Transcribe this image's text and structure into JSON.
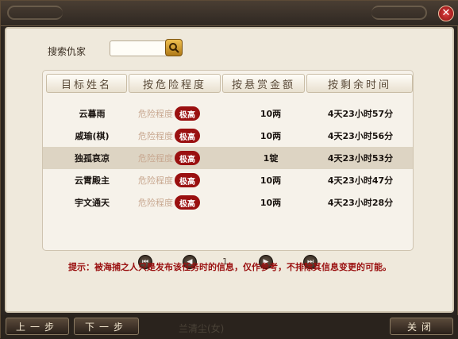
{
  "window": {
    "close_glyph": "✕"
  },
  "search": {
    "label": "搜索仇家",
    "value": ""
  },
  "columns": [
    "目标姓名",
    "按危险程度",
    "按悬赏金额",
    "按剩余时间"
  ],
  "rows": [
    {
      "name": "云暮雨",
      "danger": "危险程度",
      "level": "极高",
      "reward": "10两",
      "time": "4天23小时57分",
      "selected": false
    },
    {
      "name": "戚瑜(棋)",
      "danger": "危险程度",
      "level": "极高",
      "reward": "10两",
      "time": "4天23小时56分",
      "selected": false
    },
    {
      "name": "独孤哀凉",
      "danger": "危险程度",
      "level": "极高",
      "reward": "1锭",
      "time": "4天23小时53分",
      "selected": true
    },
    {
      "name": "云霄殿主",
      "danger": "危险程度",
      "level": "极高",
      "reward": "10两",
      "time": "4天23小时47分",
      "selected": false
    },
    {
      "name": "宇文通天",
      "danger": "危险程度",
      "level": "极高",
      "reward": "10两",
      "time": "4天23小时28分",
      "selected": false
    }
  ],
  "pager": {
    "page": "1",
    "first": "⏮",
    "prev": "◀",
    "next": "▶",
    "last": "⏭"
  },
  "tip": "提示：被海捕之人只是发布该任务时的信息，仅作参考，不排除其信息变更的可能。",
  "buttons": {
    "prev_step": "上一步",
    "next_step": "下一步",
    "close": "关闭"
  },
  "behind_text": "兰清尘(女)"
}
